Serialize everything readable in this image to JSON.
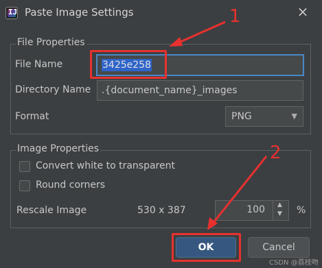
{
  "window": {
    "title": "Paste Image Settings",
    "close_icon": "×",
    "app_icon": "IJ"
  },
  "file_properties": {
    "group_title": "File Properties",
    "file_name_label": "File Name",
    "file_name_value": "3425e258",
    "directory_label": "Directory Name",
    "directory_value": ".{document_name}_images",
    "format_label": "Format",
    "format_value": "PNG"
  },
  "image_properties": {
    "group_title": "Image Properties",
    "convert_label": "Convert white to transparent",
    "round_label": "Round corners",
    "rescale_label": "Rescale Image",
    "dimensions": "530 x 387",
    "scale_value": "100",
    "percent": "%"
  },
  "buttons": {
    "ok": "OK",
    "cancel": "Cancel"
  },
  "annotations": {
    "marker1": "1",
    "marker2": "2"
  },
  "watermark": "CSDN @荔枝吻",
  "colors": {
    "annotation": "#e8312f",
    "selection": "#2f65ca",
    "ok_button": "#365880"
  }
}
